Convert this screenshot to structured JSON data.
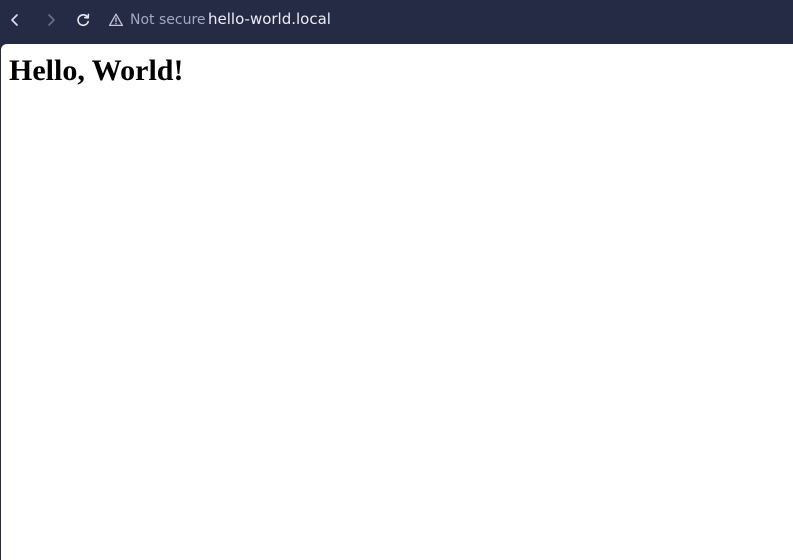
{
  "toolbar": {
    "back_icon": "chevron-left-icon",
    "forward_icon": "chevron-right-icon",
    "reload_icon": "reload-icon",
    "security_icon": "warning-triangle-icon",
    "security_label": "Not secure",
    "url": "hello-world.local",
    "colors": {
      "background": "#262b45",
      "icon_active": "#e6e8f0",
      "icon_disabled": "#6b7089",
      "security_text": "#a3a8bd",
      "url_text": "#eceef5"
    }
  },
  "page": {
    "heading": "Hello, World!",
    "background": "#ffffff"
  }
}
